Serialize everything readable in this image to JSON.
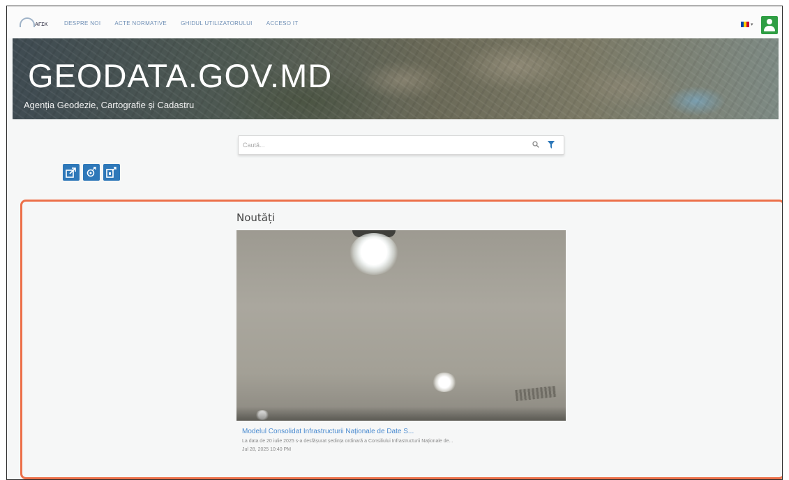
{
  "nav": {
    "logo_text": "ΑΓΣΚ",
    "items": [
      {
        "label": "DESPRE NOI"
      },
      {
        "label": "ACTE NORMATIVE"
      },
      {
        "label": "GHIDUL UTILIZATORULUI"
      },
      {
        "label": "ACCESO IT"
      }
    ],
    "language_flag_colors": [
      "#0046ae",
      "#ffd200",
      "#cc092f"
    ],
    "user_icon": "user-icon",
    "user_button_color": "#2f9e44"
  },
  "hero": {
    "title": "GEODATA.GOV.MD",
    "subtitle": "Agenția Geodezie, Cartografie și Cadastru"
  },
  "search": {
    "placeholder": "Caută..."
  },
  "actions": [
    {
      "icon": "login-icon"
    },
    {
      "icon": "settings-icon"
    },
    {
      "icon": "logout-icon"
    }
  ],
  "news": {
    "heading": "Noutăți",
    "article": {
      "title": "Modelul Consolidat Infrastructurii Naționale de Date S...",
      "excerpt": "La data de 20 iulie 2025 s-a desfășurat ședința ordinară a Consiliului Infrastructurii Naționale de...",
      "date": "Jul 28, 2025 10:40 PM"
    }
  },
  "colors": {
    "accent": "#2e78b9",
    "news_border": "#ec7049",
    "link": "#4a8bd0"
  }
}
